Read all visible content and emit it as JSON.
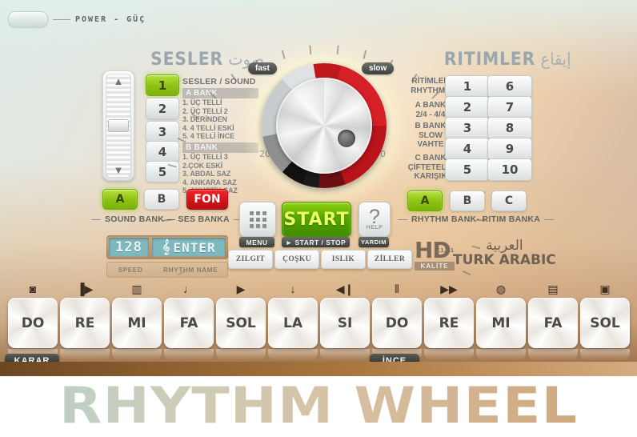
{
  "power": {
    "label": "POWER - GÜÇ",
    "icon": "power-switch-icon"
  },
  "title": "RHYTHM WHEEL",
  "sounds": {
    "heading_latin": "SESLER",
    "heading_arabic": "صوت",
    "list_title": "SESLER / SOUND",
    "numbers": [
      "1",
      "2",
      "3",
      "4",
      "5"
    ],
    "active_number": "1",
    "banks": [
      {
        "name": "A BANK",
        "items": [
          "1. ÜÇ TELLİ",
          "2. ÜÇ TELLİ 2",
          "3. DERİNDEN",
          "4. 4 TELLİ ESKİ",
          "5. 4 TELLİ İNCE"
        ]
      },
      {
        "name": "B BANK",
        "items": [
          "1. ÜÇ TELLİ 3",
          "2.ÇOK ESKİ",
          "3. ABDAL SAZ",
          "4. ANKARA SAZ",
          "5. AKUSTİK SAZ"
        ]
      }
    ],
    "bank_buttons": [
      "A",
      "B"
    ],
    "bank_active": "A",
    "fon_button": "FON",
    "bank_rule_label": "SOUND BANK — SES  BANKA"
  },
  "wheel": {
    "fast_label": "fast",
    "slow_label": "slow",
    "tick_labels": [
      "20",
      "0"
    ]
  },
  "rhythms": {
    "heading_latin": "RITIMLER",
    "heading_arabic": "إيقاع",
    "labels": [
      "RİTİMLER\nRHYTHMS",
      "A BANK\n2/4 - 4/4",
      "B BANK\nSLOW\nVAHTE",
      "C BANK\nÇİFTETELLİ\nKARIŞIK"
    ],
    "numbers_left": [
      "1",
      "2",
      "3",
      "4",
      "5"
    ],
    "numbers_right": [
      "6",
      "7",
      "8",
      "9",
      "10"
    ],
    "bank_buttons": [
      "A",
      "B",
      "C"
    ],
    "bank_active": "A",
    "bank_rule_label": "RHYTHM BANK- RITIM BANKA"
  },
  "display": {
    "speed_value": "128",
    "enter_label": "ENTER",
    "clef_icon": "treble-clef-icon",
    "speed_caption": "SPEED",
    "rhythm_name_caption": "RHYTHM NAME"
  },
  "transport": {
    "menu_icon": "grid-dots-icon",
    "menu_tag": "MENU",
    "start_label": "START",
    "start_tag": "► START / STOP",
    "help_glyph": "?",
    "help_sub": "HELP",
    "help_tag": "YARDIM"
  },
  "effects": [
    "ZILGIT",
    "ÇOŞKU",
    "ISLIK",
    "ZİLLER"
  ],
  "branding": {
    "hd": "HD",
    "hd_sub": "KALİTE",
    "version": "V.1.0.1",
    "arabic": "العربية",
    "latin": "TURK ARABIC"
  },
  "keyboard": {
    "keys": [
      "DO",
      "RE",
      "MI",
      "FA",
      "SOL",
      "LA",
      "SI",
      "DO",
      "RE",
      "MI",
      "FA",
      "SOL"
    ],
    "icons": [
      "stop-square-icon",
      "skip-forward-icon",
      "organ-icon",
      "music-note-icon",
      "play-icon",
      "microphone-icon",
      "speaker-mute-icon",
      "sliders-icon",
      "fast-forward-icon",
      "handheld-mic-icon",
      "clapperboard-icon",
      "speaker-box-icon"
    ],
    "icon_glyphs": [
      "◙",
      "▐▶",
      "▥",
      "♩",
      "▶",
      "↓",
      "◀❙",
      "⦀",
      "▶▶",
      "◍",
      "▤",
      "▣"
    ],
    "tag_left": "KARAR",
    "tag_mid": "İNCE"
  },
  "colors": {
    "accent_green": "#8fc415",
    "accent_red": "#d3151a",
    "lcd": "#7fb8bf",
    "dial_red": "#c0171c"
  }
}
